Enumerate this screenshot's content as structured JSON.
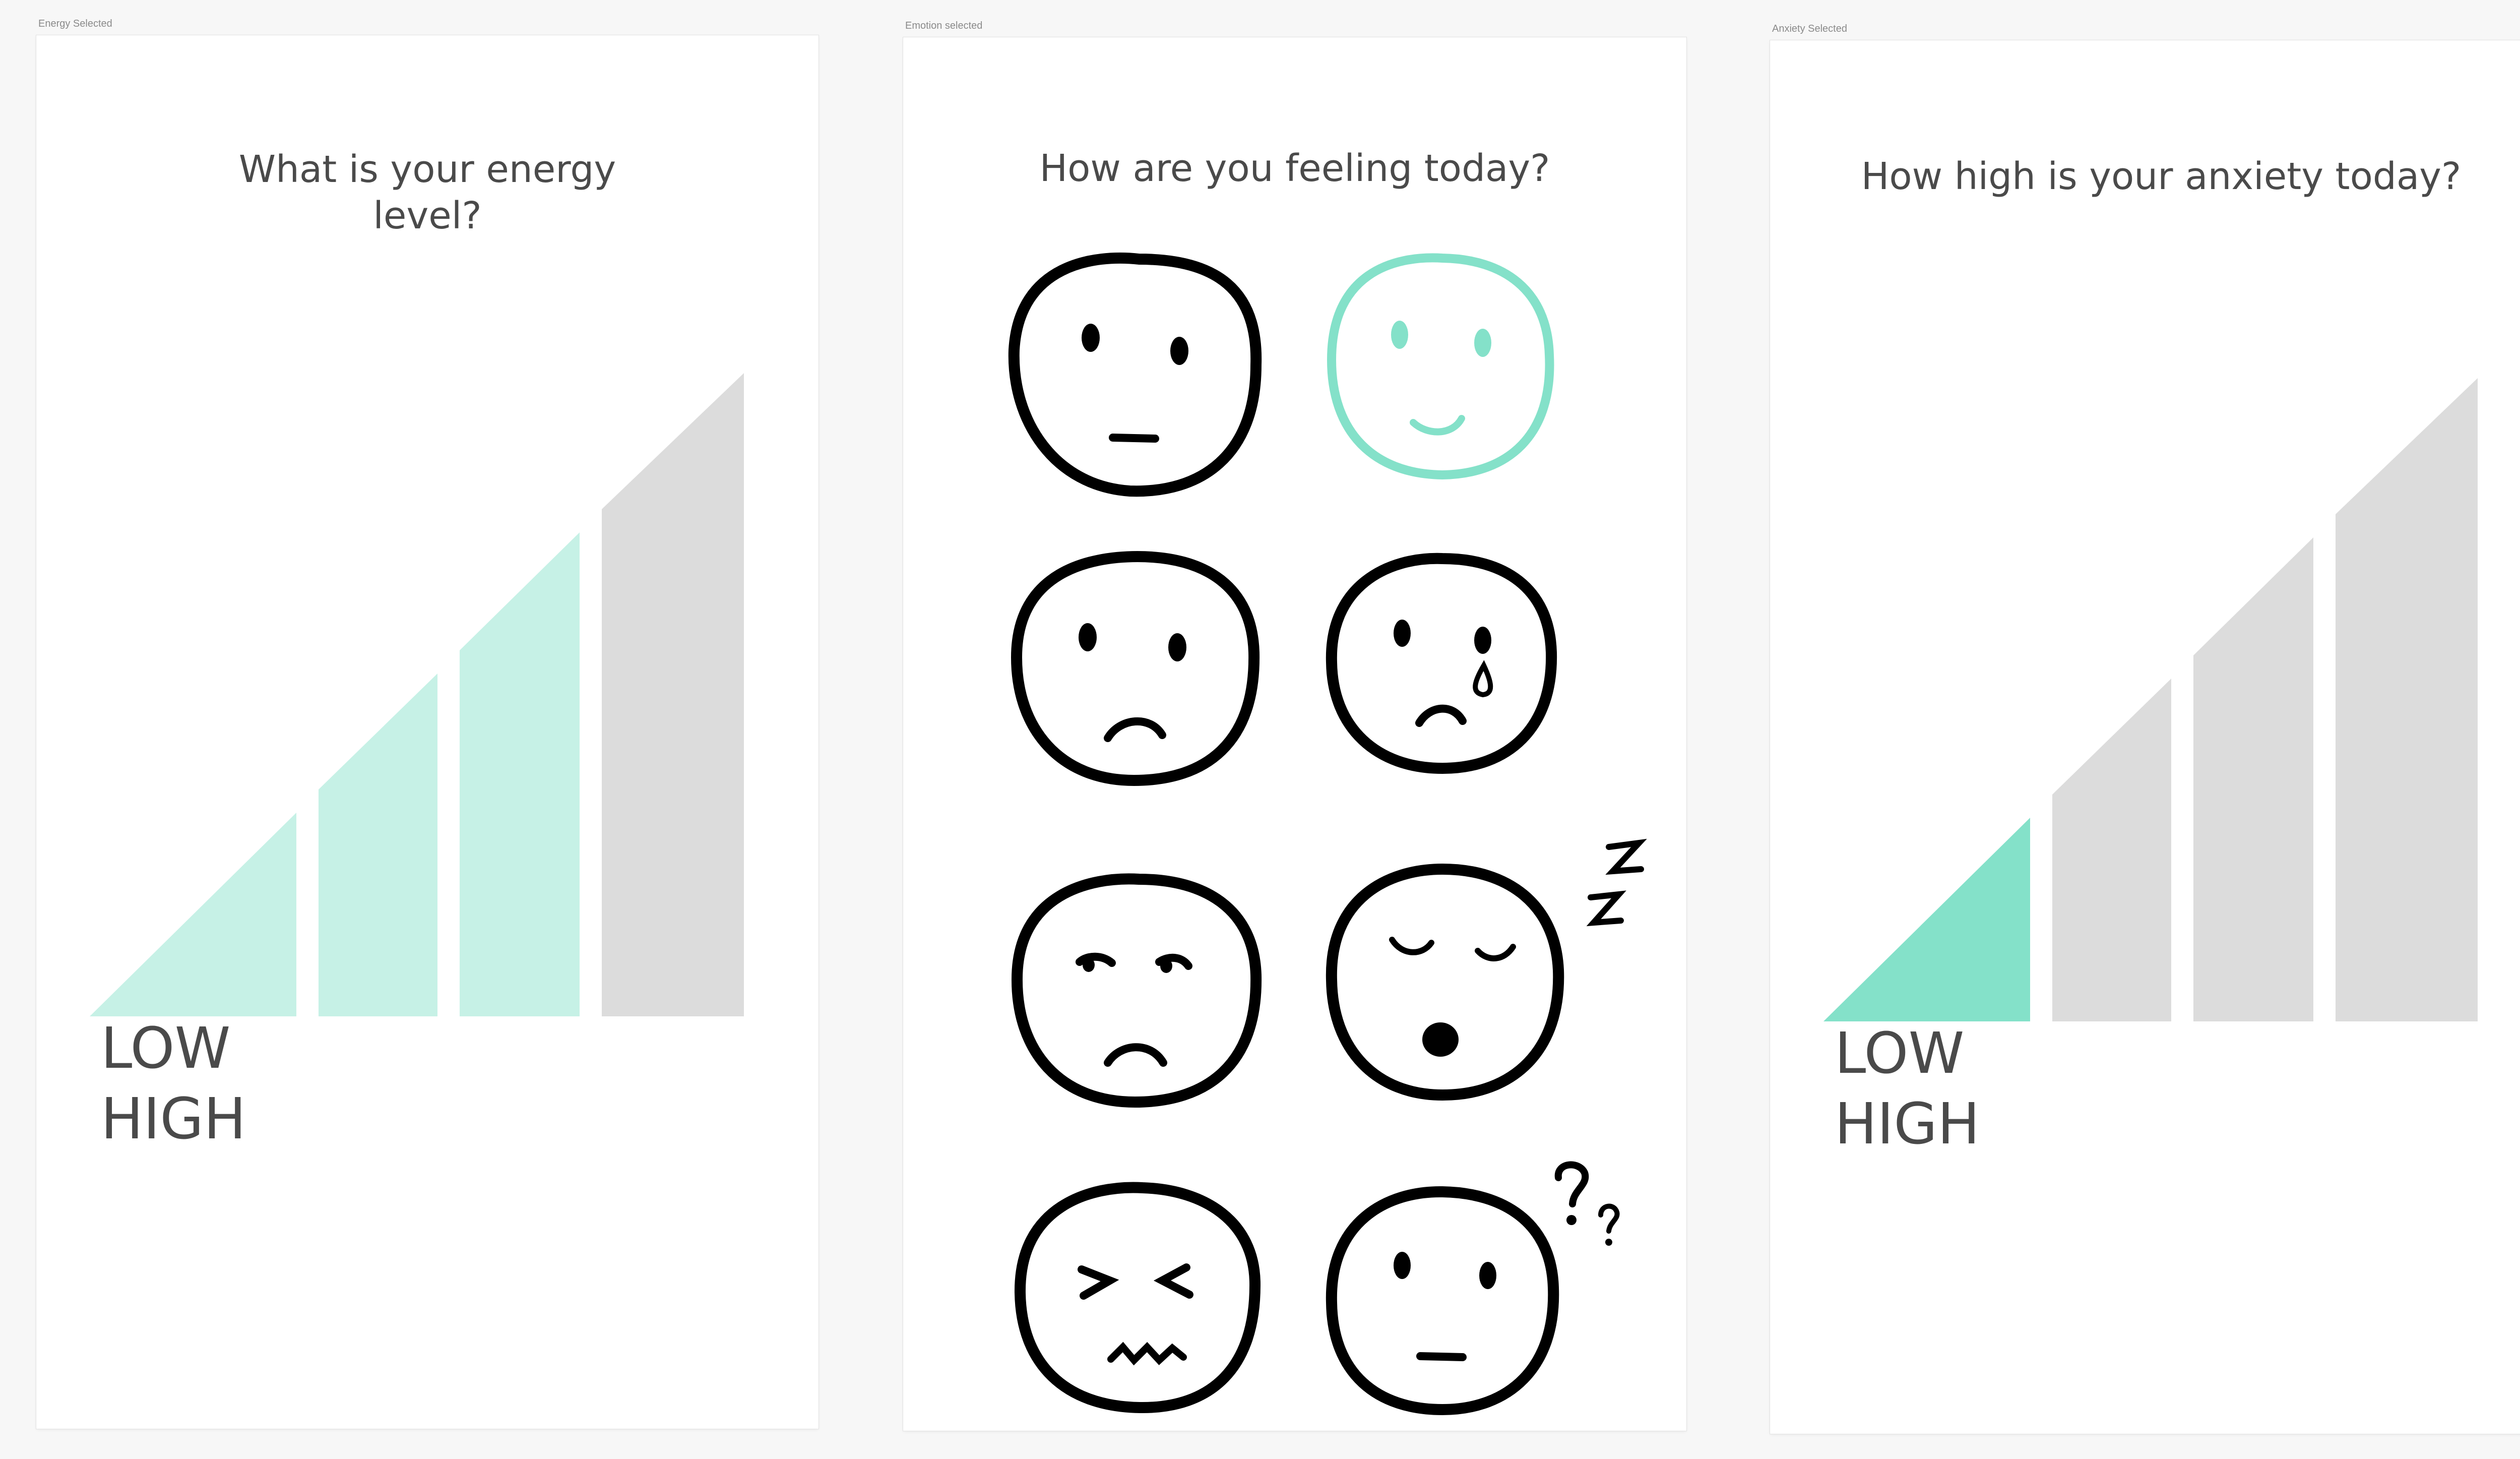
{
  "screens": [
    {
      "frame_label": "Energy Selected",
      "question": "What is your energy level?",
      "low_label": "LOW",
      "high_label": "HIGH",
      "levels_total": 4,
      "levels_selected": 3
    },
    {
      "frame_label": "Emotion selected",
      "question": "How are you feeling today?",
      "faces": [
        {
          "icon": "neutral-face-icon",
          "selected": false
        },
        {
          "icon": "smiling-face-icon",
          "selected": true
        },
        {
          "icon": "sad-face-icon",
          "selected": false
        },
        {
          "icon": "crying-face-icon",
          "selected": false
        },
        {
          "icon": "annoyed-face-icon",
          "selected": false
        },
        {
          "icon": "sleepy-face-icon",
          "selected": false
        },
        {
          "icon": "stressed-face-icon",
          "selected": false
        },
        {
          "icon": "confused-face-icon",
          "selected": false
        }
      ]
    },
    {
      "frame_label": "Anxiety Selected",
      "question": "How high is your anxiety today?",
      "low_label": "LOW",
      "high_label": "HIGH",
      "levels_total": 4,
      "levels_selected": 1
    }
  ],
  "colors": {
    "selected_light": "#c6f1e6",
    "selected_strong": "#84e1c9",
    "unselected": "#dcdcdc",
    "face_stroke": "#000000",
    "face_selected_stroke": "#84e1c9"
  }
}
